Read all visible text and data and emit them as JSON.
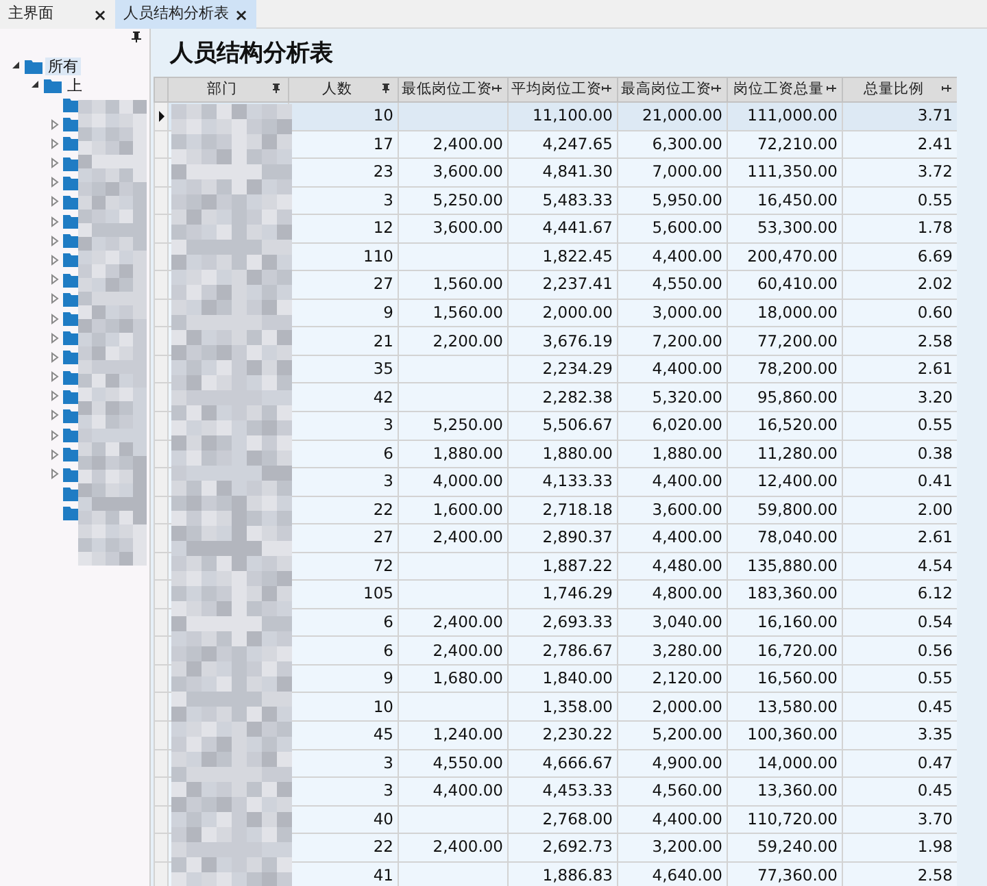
{
  "tabs": [
    {
      "label": "主界面",
      "close": "×",
      "selected": false
    },
    {
      "label": "人员结构分析表",
      "close": "×",
      "selected": true
    }
  ],
  "tree": {
    "items": [
      {
        "label": "所有",
        "expanded": true,
        "selected": true,
        "children": [
          {
            "label": "上",
            "expanded": true,
            "children": [
              {
                "expandable": false
              },
              {
                "expandable": true
              },
              {
                "expandable": true
              },
              {
                "expandable": true
              },
              {
                "expandable": true
              },
              {
                "expandable": true
              },
              {
                "expandable": true
              },
              {
                "expandable": true
              },
              {
                "expandable": true
              },
              {
                "expandable": true
              },
              {
                "expandable": true
              },
              {
                "expandable": true
              },
              {
                "expandable": true
              },
              {
                "expandable": true
              },
              {
                "expandable": true
              },
              {
                "expandable": true
              },
              {
                "expandable": true
              },
              {
                "expandable": true
              },
              {
                "expandable": true
              },
              {
                "expandable": true
              },
              {
                "expandable": false
              },
              {
                "expandable": false
              }
            ]
          }
        ]
      }
    ]
  },
  "report": {
    "title": "人员结构分析表",
    "table": {
      "columns": [
        "部门",
        "人数",
        "最低岗位工资",
        "平均岗位工资",
        "最高岗位工资",
        "岗位工资总量",
        "总量比例"
      ],
      "rows": [
        {
          "selected": true,
          "count": "10",
          "avg_wage": "11,100.00",
          "max_wage": "21,000.00",
          "total_wage": "111,000.00",
          "ratio": "3.71"
        },
        {
          "selected": false,
          "count": "17",
          "min_wage": "2,400.00",
          "avg_wage": "4,247.65",
          "max_wage": "6,300.00",
          "total_wage": "72,210.00",
          "ratio": "2.41"
        },
        {
          "selected": false,
          "count": "23",
          "min_wage": "3,600.00",
          "avg_wage": "4,841.30",
          "max_wage": "7,000.00",
          "total_wage": "111,350.00",
          "ratio": "3.72"
        },
        {
          "selected": false,
          "count": "3",
          "min_wage": "5,250.00",
          "avg_wage": "5,483.33",
          "max_wage": "5,950.00",
          "total_wage": "16,450.00",
          "ratio": "0.55"
        },
        {
          "selected": false,
          "count": "12",
          "min_wage": "3,600.00",
          "avg_wage": "4,441.67",
          "max_wage": "5,600.00",
          "total_wage": "53,300.00",
          "ratio": "1.78"
        },
        {
          "selected": false,
          "count": "110",
          "avg_wage": "1,822.45",
          "max_wage": "4,400.00",
          "total_wage": "200,470.00",
          "ratio": "6.69"
        },
        {
          "selected": false,
          "count": "27",
          "min_wage": "1,560.00",
          "avg_wage": "2,237.41",
          "max_wage": "4,550.00",
          "total_wage": "60,410.00",
          "ratio": "2.02"
        },
        {
          "selected": false,
          "count": "9",
          "min_wage": "1,560.00",
          "avg_wage": "2,000.00",
          "max_wage": "3,000.00",
          "total_wage": "18,000.00",
          "ratio": "0.60"
        },
        {
          "selected": false,
          "count": "21",
          "min_wage": "2,200.00",
          "avg_wage": "3,676.19",
          "max_wage": "7,200.00",
          "total_wage": "77,200.00",
          "ratio": "2.58"
        },
        {
          "selected": false,
          "count": "35",
          "avg_wage": "2,234.29",
          "max_wage": "4,400.00",
          "total_wage": "78,200.00",
          "ratio": "2.61"
        },
        {
          "selected": false,
          "count": "42",
          "avg_wage": "2,282.38",
          "max_wage": "5,320.00",
          "total_wage": "95,860.00",
          "ratio": "3.20"
        },
        {
          "selected": false,
          "count": "3",
          "min_wage": "5,250.00",
          "avg_wage": "5,506.67",
          "max_wage": "6,020.00",
          "total_wage": "16,520.00",
          "ratio": "0.55"
        },
        {
          "selected": false,
          "count": "6",
          "min_wage": "1,880.00",
          "avg_wage": "1,880.00",
          "max_wage": "1,880.00",
          "total_wage": "11,280.00",
          "ratio": "0.38"
        },
        {
          "selected": false,
          "count": "3",
          "min_wage": "4,000.00",
          "avg_wage": "4,133.33",
          "max_wage": "4,400.00",
          "total_wage": "12,400.00",
          "ratio": "0.41"
        },
        {
          "selected": false,
          "count": "22",
          "min_wage": "1,600.00",
          "avg_wage": "2,718.18",
          "max_wage": "3,600.00",
          "total_wage": "59,800.00",
          "ratio": "2.00"
        },
        {
          "selected": false,
          "count": "27",
          "min_wage": "2,400.00",
          "avg_wage": "2,890.37",
          "max_wage": "4,400.00",
          "total_wage": "78,040.00",
          "ratio": "2.61"
        },
        {
          "selected": false,
          "count": "72",
          "avg_wage": "1,887.22",
          "max_wage": "4,480.00",
          "total_wage": "135,880.00",
          "ratio": "4.54"
        },
        {
          "selected": false,
          "count": "105",
          "avg_wage": "1,746.29",
          "max_wage": "4,800.00",
          "total_wage": "183,360.00",
          "ratio": "6.12"
        },
        {
          "selected": false,
          "count": "6",
          "min_wage": "2,400.00",
          "avg_wage": "2,693.33",
          "max_wage": "3,040.00",
          "total_wage": "16,160.00",
          "ratio": "0.54"
        },
        {
          "selected": false,
          "count": "6",
          "min_wage": "2,400.00",
          "avg_wage": "2,786.67",
          "max_wage": "3,280.00",
          "total_wage": "16,720.00",
          "ratio": "0.56"
        },
        {
          "selected": false,
          "count": "9",
          "min_wage": "1,680.00",
          "avg_wage": "1,840.00",
          "max_wage": "2,120.00",
          "total_wage": "16,560.00",
          "ratio": "0.55"
        },
        {
          "selected": false,
          "count": "10",
          "avg_wage": "1,358.00",
          "max_wage": "2,000.00",
          "total_wage": "13,580.00",
          "ratio": "0.45"
        },
        {
          "selected": false,
          "count": "45",
          "min_wage": "1,240.00",
          "avg_wage": "2,230.22",
          "max_wage": "5,200.00",
          "total_wage": "100,360.00",
          "ratio": "3.35"
        },
        {
          "selected": false,
          "count": "3",
          "min_wage": "4,550.00",
          "avg_wage": "4,666.67",
          "max_wage": "4,900.00",
          "total_wage": "14,000.00",
          "ratio": "0.47"
        },
        {
          "selected": false,
          "count": "3",
          "min_wage": "4,400.00",
          "avg_wage": "4,453.33",
          "max_wage": "4,560.00",
          "total_wage": "13,360.00",
          "ratio": "0.45"
        },
        {
          "selected": false,
          "count": "40",
          "avg_wage": "2,768.00",
          "max_wage": "4,400.00",
          "total_wage": "110,720.00",
          "ratio": "3.70"
        },
        {
          "selected": false,
          "count": "22",
          "min_wage": "2,400.00",
          "avg_wage": "2,692.73",
          "max_wage": "3,200.00",
          "total_wage": "59,240.00",
          "ratio": "1.98"
        },
        {
          "selected": false,
          "count": "41",
          "avg_wage": "1,886.83",
          "max_wage": "4,640.00",
          "total_wage": "77,360.00",
          "ratio": "2.58"
        }
      ]
    }
  }
}
